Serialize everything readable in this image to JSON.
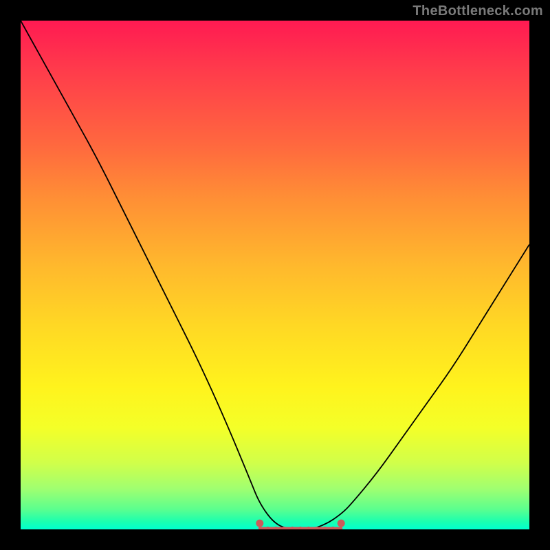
{
  "watermark": "TheBottleneck.com",
  "chart_data": {
    "type": "line",
    "title": "",
    "xlabel": "",
    "ylabel": "",
    "xlim": [
      0,
      100
    ],
    "ylim": [
      0,
      100
    ],
    "series": [
      {
        "name": "bottleneck-curve",
        "x": [
          0,
          5,
          10,
          15,
          20,
          25,
          30,
          35,
          40,
          45,
          47,
          50,
          53,
          55,
          57,
          60,
          63,
          65,
          70,
          75,
          80,
          85,
          90,
          95,
          100
        ],
        "values": [
          100,
          91,
          82,
          73,
          63,
          53,
          43,
          33,
          22,
          10,
          5,
          1,
          0,
          0,
          0,
          1,
          3,
          5,
          11,
          18,
          25,
          32,
          40,
          48,
          56
        ]
      }
    ],
    "annotations": [
      {
        "name": "optimal-zone",
        "x_start": 47,
        "x_end": 63,
        "y": 0
      }
    ],
    "background_gradient": {
      "top_color": "#ff1a52",
      "bottom_color": "#00ffcf"
    }
  }
}
